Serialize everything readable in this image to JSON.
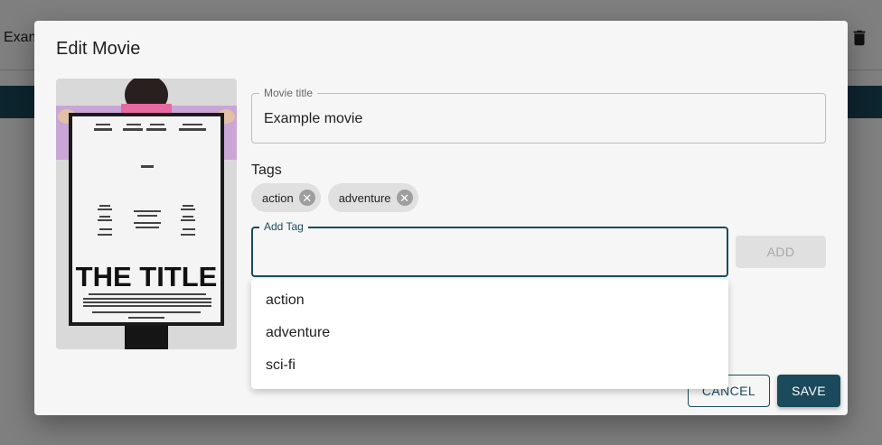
{
  "background": {
    "item_text": "Example movie",
    "trash_icon": "trash-icon"
  },
  "dialog": {
    "title": "Edit Movie",
    "poster": {
      "camera_icon": "camera-icon",
      "title_text": "THE TITLE"
    },
    "movie_title": {
      "label": "Movie title",
      "value": "Example movie"
    },
    "tags": {
      "label": "Tags",
      "chips": [
        {
          "label": "action"
        },
        {
          "label": "adventure"
        }
      ]
    },
    "add_tag": {
      "label": "Add Tag",
      "value": "",
      "button_label": "ADD"
    },
    "suggestions": [
      "action",
      "adventure",
      "sci-fi"
    ],
    "cancel_label": "CANCEL",
    "save_label": "SAVE"
  },
  "colors": {
    "primary": "#1b4a5c",
    "dialog_bg": "#f6f6f6",
    "chip_bg": "#e0e0e0"
  }
}
